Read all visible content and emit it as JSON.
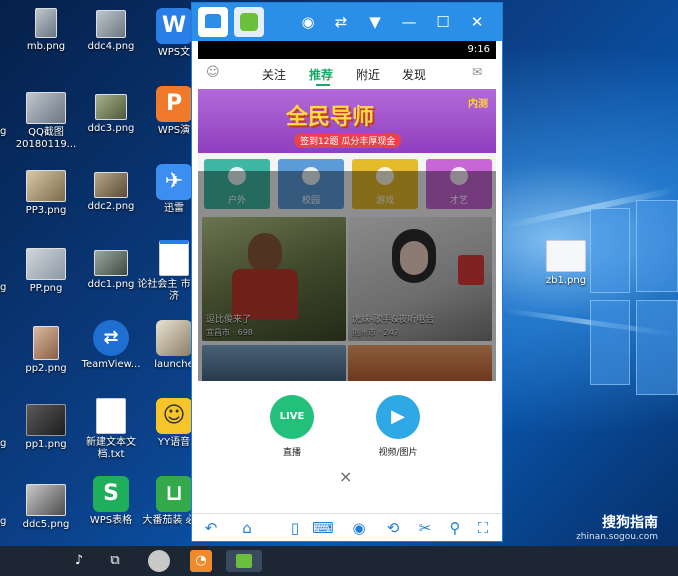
{
  "desktop_icons": [
    {
      "label": "mb.png"
    },
    {
      "label": "ddc4.png"
    },
    {
      "label": "WPS文"
    },
    {
      "label": "QQ截图 20180119..."
    },
    {
      "label": "ddc3.png"
    },
    {
      "label": "WPS演"
    },
    {
      "label": "PP3.png"
    },
    {
      "label": "ddc2.png"
    },
    {
      "label": "迅雷"
    },
    {
      "label": "PP.png"
    },
    {
      "label": "ddc1.png"
    },
    {
      "label": "论社会主 市场经济"
    },
    {
      "label": "pp2.png"
    },
    {
      "label": "TeamView..."
    },
    {
      "label": "launche"
    },
    {
      "label": "pp1.png"
    },
    {
      "label": "新建文本文 档.txt"
    },
    {
      "label": "YY语音"
    },
    {
      "label": "ddc5.png"
    },
    {
      "label": "WPS表格"
    },
    {
      "label": "大番茄装 必备"
    },
    {
      "label": "zb1.png"
    }
  ],
  "edge_labels": [
    "g",
    "g",
    "g",
    "g"
  ],
  "phone": {
    "time": "9:16",
    "tabs": [
      "关注",
      "推荐",
      "附近",
      "发现"
    ],
    "banner_title": "全民导师",
    "banner_sub": "签到12题 瓜分丰厚现金",
    "banner_tag": "内测",
    "categories": [
      "户外",
      "校园",
      "游戏",
      "才艺"
    ],
    "cards": [
      {
        "caption": "逗比俊来了",
        "meta": "宜昌市 · 698"
      },
      {
        "caption": "虎妹-歌手&夜听电台",
        "meta": "荆州市 · 247"
      }
    ],
    "actions": [
      "直播",
      "视频/图片"
    ],
    "live_circle": "LIVE",
    "close": "×"
  },
  "watermark": {
    "line1": "搜狗指南",
    "line2": "zhinan.sogou.com"
  },
  "colors": {
    "accent_green": "#1aa86a",
    "emulator_blue": "#2b8fe8",
    "live_green": "#22c07a",
    "video_blue": "#2fa8e6"
  }
}
